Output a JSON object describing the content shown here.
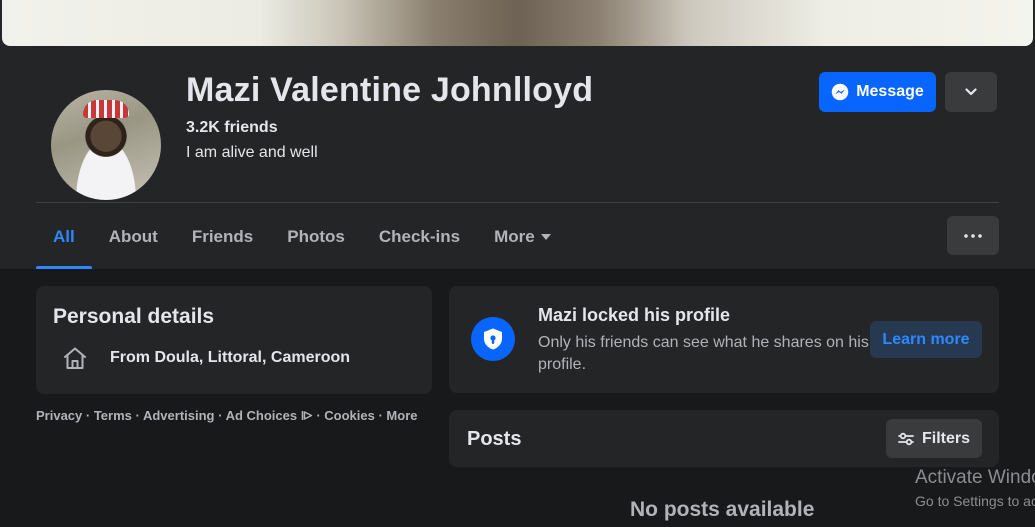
{
  "profile": {
    "name": "Mazi Valentine Johnlloyd",
    "friends_count": "3.2K friends",
    "bio": "I am alive and well"
  },
  "actions": {
    "message_label": "Message",
    "more_actions_icon": "chevron-down-icon"
  },
  "tabs": [
    {
      "label": "All",
      "active": true
    },
    {
      "label": "About",
      "active": false
    },
    {
      "label": "Friends",
      "active": false
    },
    {
      "label": "Photos",
      "active": false
    },
    {
      "label": "Check-ins",
      "active": false
    },
    {
      "label": "More",
      "active": false
    }
  ],
  "personal_details": {
    "title": "Personal details",
    "location": "From Doula, Littoral, Cameroon",
    "location_icon": "home-icon"
  },
  "footer": {
    "privacy": "Privacy",
    "terms": "Terms",
    "advertising": "Advertising",
    "ad_choices": "Ad Choices",
    "cookies": "Cookies",
    "more": "More"
  },
  "locked_notice": {
    "title": "Mazi locked his profile",
    "text": "Only his friends can see what he shares on his profile.",
    "button": "Learn more",
    "icon": "shield-lock-icon"
  },
  "posts": {
    "title": "Posts",
    "filters_label": "Filters",
    "empty_text": "No posts available"
  },
  "watermark": {
    "title": "Activate Windows",
    "subtitle": "Go to Settings to activate Windows."
  },
  "colors": {
    "background": "#18191a",
    "card": "#242526",
    "accent": "#0866ff",
    "active_tab": "#2d88ff"
  }
}
